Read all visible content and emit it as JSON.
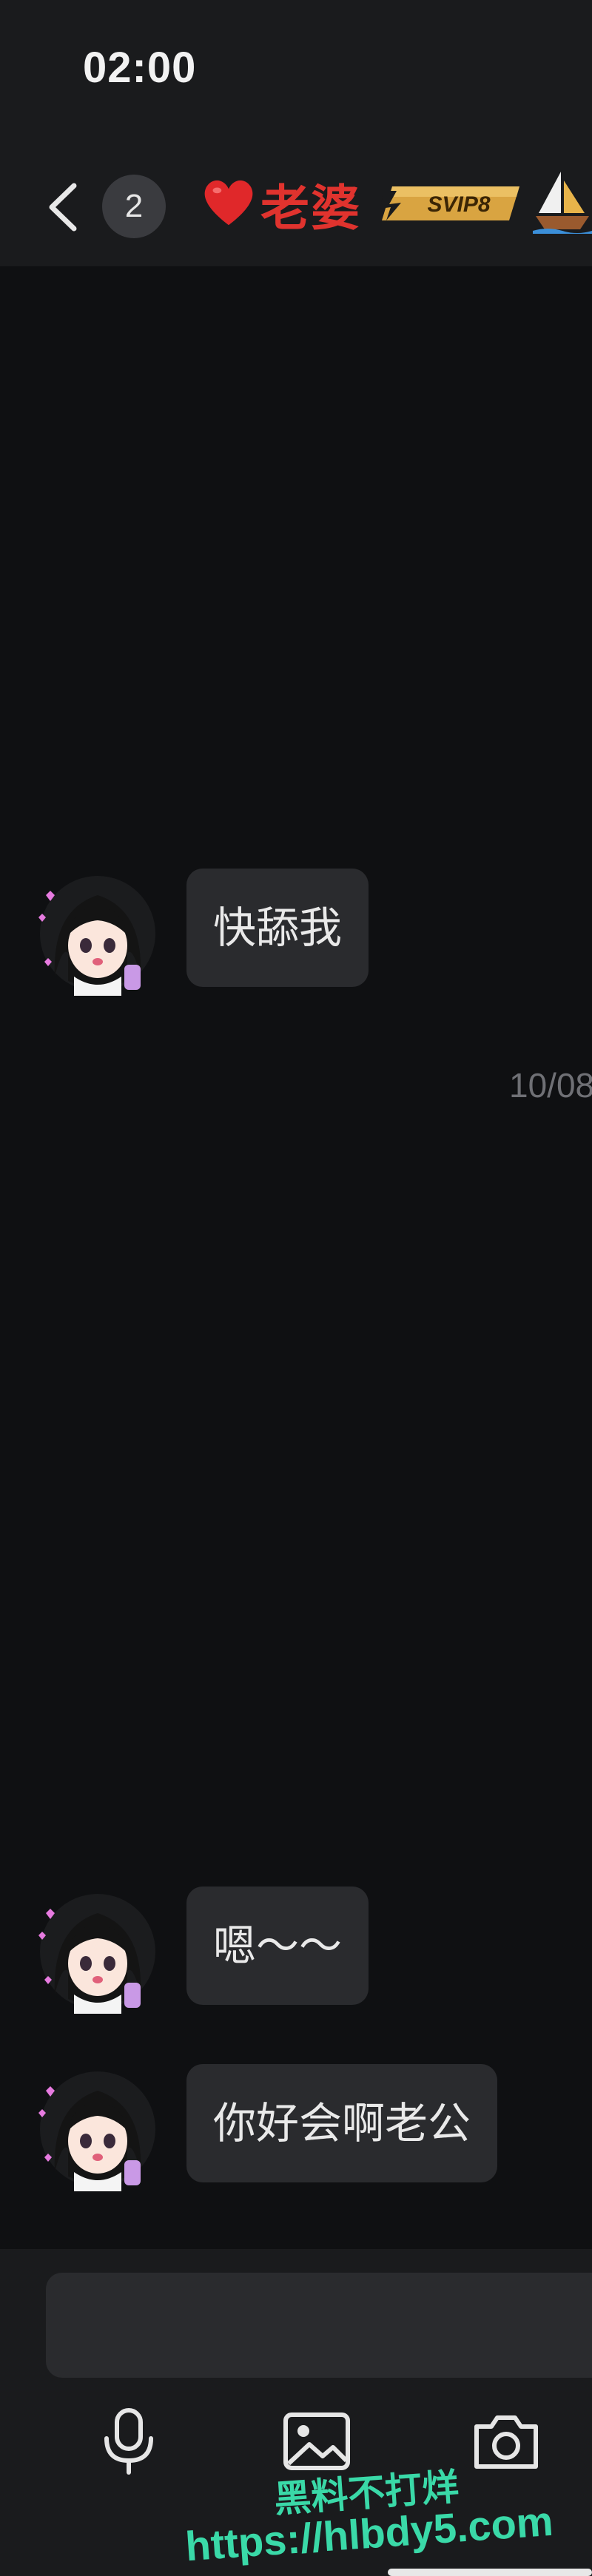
{
  "status_bar": {
    "time": "02:00"
  },
  "header": {
    "back_icon": "chevron-left-icon",
    "unread_count": "2",
    "contact_name": "老婆",
    "heart_icon": "heart-icon",
    "vip_badge": "SVIP8",
    "boat_icon": "sailboat-icon"
  },
  "messages": [
    {
      "text": "快舔我"
    },
    {
      "text": "嗯～～"
    },
    {
      "text": "你好会啊老公"
    }
  ],
  "timestamp": "10/08",
  "toolbar": {
    "icons": [
      "microphone-icon",
      "image-icon",
      "camera-icon"
    ]
  },
  "watermark": {
    "line1": "黑料不打烊",
    "line2": "https://hlbdy5.com"
  },
  "colors": {
    "background": "#0f1012",
    "bar": "#1a1b1d",
    "bubble": "#2a2b2e",
    "name": "#e0332e",
    "watermark": "#3ad9a8"
  }
}
